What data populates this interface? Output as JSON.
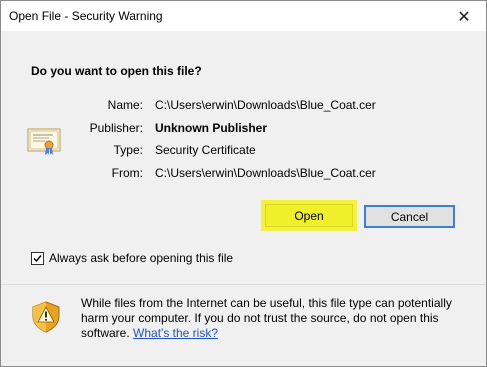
{
  "dialog": {
    "title": "Open File - Security Warning",
    "close_glyph": "✕",
    "question": "Do you want to open this file?"
  },
  "file_info": {
    "name_label": "Name:",
    "name_value": "C:\\Users\\erwin\\Downloads\\Blue_Coat.cer",
    "publisher_label": "Publisher:",
    "publisher_value": "Unknown Publisher",
    "type_label": "Type:",
    "type_value": "Security Certificate",
    "from_label": "From:",
    "from_value": "C:\\Users\\erwin\\Downloads\\Blue_Coat.cer"
  },
  "buttons": {
    "open_label": "Open",
    "cancel_label": "Cancel"
  },
  "checkbox": {
    "label": "Always ask before opening this file",
    "checked": true
  },
  "footer": {
    "warning_text": "While files from the Internet can be useful, this file type can potentially harm your computer. If you do not trust the source, do not open this software. ",
    "risk_link": "What's the risk?"
  },
  "icons": {
    "certificate": "certificate-icon",
    "shield": "shield-warning-icon",
    "close": "close-icon",
    "check": "checkmark-icon"
  },
  "colors": {
    "highlight": "#f1ee2a",
    "link": "#1f54c6",
    "focus_border": "#3c7fd6"
  }
}
